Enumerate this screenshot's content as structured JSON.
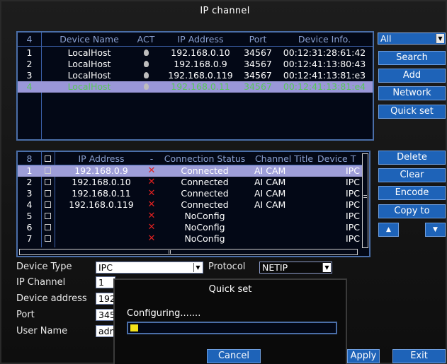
{
  "window": {
    "title": "IP channel"
  },
  "search_panel": {
    "header": {
      "count": "4",
      "device_name": "Device Name",
      "act": "ACT",
      "ip": "IP Address",
      "port": "Port",
      "info": "Device Info."
    },
    "rows": [
      {
        "num": "1",
        "name": "LocalHost",
        "ip": "192.168.0.10",
        "port": "34567",
        "info": "00:12:31:28:61:42"
      },
      {
        "num": "2",
        "name": "LocalHost",
        "ip": "192.168.0.9",
        "port": "34567",
        "info": "00:12:41:13:80:43"
      },
      {
        "num": "3",
        "name": "LocalHost",
        "ip": "192.168.0.119",
        "port": "34567",
        "info": "00:12:41:13:81:e3"
      },
      {
        "num": "4",
        "name": "LocalHost",
        "ip": "192.168.0.11",
        "port": "34567",
        "info": "00:12:41:13:81:e4"
      }
    ],
    "filter_value": "All",
    "buttons": {
      "search": "Search",
      "add": "Add",
      "network": "Network",
      "quick_set": "Quick set"
    }
  },
  "channel_panel": {
    "header": {
      "count": "8",
      "ip": "IP Address",
      "dash": "-",
      "status": "Connection Status",
      "title": "Channel Title",
      "device_type": "Device T"
    },
    "rows": [
      {
        "num": "1",
        "ip": "192.168.0.9",
        "status": "Connected",
        "title": "AI CAM",
        "type": "IPC"
      },
      {
        "num": "2",
        "ip": "192.168.0.10",
        "status": "Connected",
        "title": "AI CAM",
        "type": "IPC"
      },
      {
        "num": "3",
        "ip": "192.168.0.11",
        "status": "Connected",
        "title": "AI CAM",
        "type": "IPC"
      },
      {
        "num": "4",
        "ip": "192.168.0.119",
        "status": "Connected",
        "title": "AI CAM",
        "type": "IPC"
      },
      {
        "num": "5",
        "ip": "",
        "status": "NoConfig",
        "title": "",
        "type": "IPC"
      },
      {
        "num": "6",
        "ip": "",
        "status": "NoConfig",
        "title": "",
        "type": "IPC"
      },
      {
        "num": "7",
        "ip": "",
        "status": "NoConfig",
        "title": "",
        "type": "IPC"
      }
    ],
    "buttons": {
      "delete": "Delete",
      "clear": "Clear",
      "encode": "Encode",
      "copy_to": "Copy to"
    }
  },
  "form": {
    "device_type_label": "Device Type",
    "device_type_value": "IPC",
    "protocol_label": "Protocol",
    "protocol_value": "NETIP",
    "ip_channel_label": "IP Channel",
    "ip_channel_value": "1",
    "device_address_label": "Device address",
    "device_address_value": "192",
    "port_label": "Port",
    "port_value": "345",
    "user_name_label": "User Name",
    "user_name_value": "adm"
  },
  "dialog": {
    "title": "Quick set",
    "message": "Configuring.......",
    "cancel": "Cancel"
  },
  "footer": {
    "apply": "Apply",
    "exit": "Exit"
  }
}
